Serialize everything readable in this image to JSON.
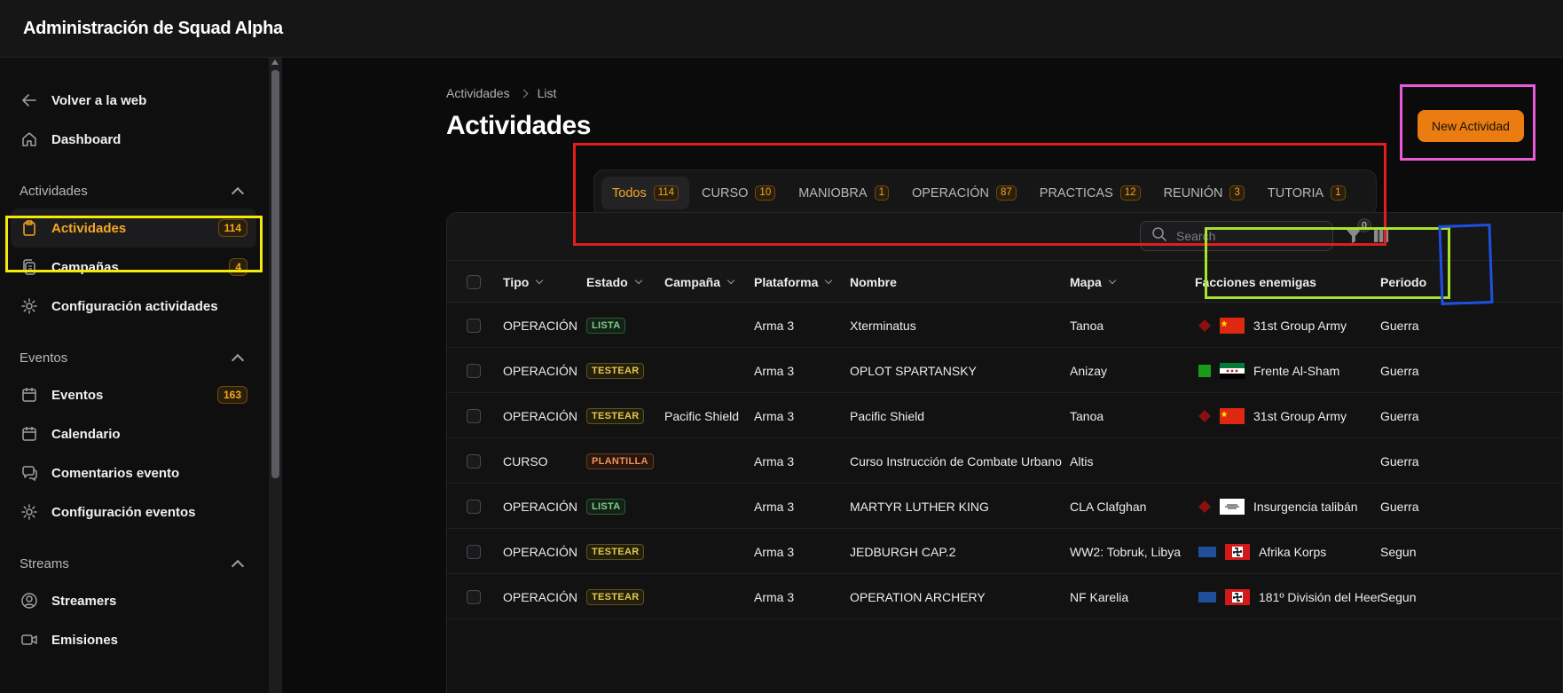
{
  "header": {
    "title": "Administración de Squad Alpha"
  },
  "sidebar": {
    "back_label": "Volver a la web",
    "dashboard_label": "Dashboard",
    "groups": [
      {
        "title": "Actividades",
        "items": [
          {
            "label": "Actividades",
            "badge": "114",
            "icon": "clipboard-icon",
            "active": true
          },
          {
            "label": "Campañas",
            "badge": "4",
            "icon": "clipboards-icon"
          },
          {
            "label": "Configuración actividades",
            "badge": "",
            "icon": "gear-icon"
          }
        ]
      },
      {
        "title": "Eventos",
        "items": [
          {
            "label": "Eventos",
            "badge": "163",
            "icon": "calendar-icon"
          },
          {
            "label": "Calendario",
            "badge": "",
            "icon": "calendar-icon"
          },
          {
            "label": "Comentarios evento",
            "badge": "",
            "icon": "chat-icon"
          },
          {
            "label": "Configuración eventos",
            "badge": "",
            "icon": "gear-icon"
          }
        ]
      },
      {
        "title": "Streams",
        "items": [
          {
            "label": "Streamers",
            "badge": "",
            "icon": "user-circle-icon"
          },
          {
            "label": "Emisiones",
            "badge": "",
            "icon": "video-icon"
          }
        ]
      }
    ]
  },
  "breadcrumb": {
    "parent": "Actividades",
    "current": "List"
  },
  "page": {
    "title": "Actividades",
    "new_button": "New Actividad"
  },
  "tabs": [
    {
      "label": "Todos",
      "count": "114",
      "active": true
    },
    {
      "label": "CURSO",
      "count": "10"
    },
    {
      "label": "MANIOBRA",
      "count": "1"
    },
    {
      "label": "OPERACIÓN",
      "count": "87"
    },
    {
      "label": "PRACTICAS",
      "count": "12"
    },
    {
      "label": "REUNIÓN",
      "count": "3"
    },
    {
      "label": "TUTORIA",
      "count": "1"
    }
  ],
  "toolbar": {
    "search_placeholder": "Search",
    "filter_count": "0"
  },
  "table": {
    "columns": [
      "Tipo",
      "Estado",
      "Campaña",
      "Plataforma",
      "Nombre",
      "Mapa",
      "Facciones enemigas",
      "Periodo"
    ],
    "rows": [
      {
        "tipo": "OPERACIÓN",
        "estado": "LISTA",
        "campana": "",
        "plataforma": "Arma 3",
        "nombre": "Xterminatus",
        "mapa": "Tanoa",
        "faccion": "31st Group Army",
        "faccion_icon": "red-diamond",
        "faccion_flag": "china-flag",
        "periodo": "Guerra"
      },
      {
        "tipo": "OPERACIÓN",
        "estado": "TESTEAR",
        "campana": "",
        "plataforma": "Arma 3",
        "nombre": "OPLOT SPARTANSKY",
        "mapa": "Anizay",
        "faccion": "Frente Al-Sham",
        "faccion_icon": "green-square",
        "faccion_flag": "syria-flag",
        "periodo": "Guerra"
      },
      {
        "tipo": "OPERACIÓN",
        "estado": "TESTEAR",
        "campana": "Pacific Shield",
        "plataforma": "Arma 3",
        "nombre": "Pacific Shield",
        "mapa": "Tanoa",
        "faccion": "31st Group Army",
        "faccion_icon": "red-diamond",
        "faccion_flag": "china-flag",
        "periodo": "Guerra"
      },
      {
        "tipo": "CURSO",
        "estado": "PLANTILLA",
        "campana": "",
        "plataforma": "Arma 3",
        "nombre": "Curso Instrucción de Combate Urbano",
        "mapa": "Altis",
        "faccion": "",
        "faccion_icon": "",
        "faccion_flag": "",
        "periodo": "Guerra"
      },
      {
        "tipo": "OPERACIÓN",
        "estado": "LISTA",
        "campana": "",
        "plataforma": "Arma 3",
        "nombre": "MARTYR LUTHER KING",
        "mapa": "CLA Clafghan",
        "faccion": "Insurgencia talibán",
        "faccion_icon": "red-diamond",
        "faccion_flag": "taliban-flag",
        "periodo": "Guerra"
      },
      {
        "tipo": "OPERACIÓN",
        "estado": "TESTEAR",
        "campana": "",
        "plataforma": "Arma 3",
        "nombre": "JEDBURGH CAP.2",
        "mapa": "WW2: Tobruk, Libya",
        "faccion": "Afrika Korps",
        "faccion_icon": "blue-rect",
        "faccion_flag": "war-flag",
        "periodo": "Segun"
      },
      {
        "tipo": "OPERACIÓN",
        "estado": "TESTEAR",
        "campana": "",
        "plataforma": "Arma 3",
        "nombre": "OPERATION ARCHERY",
        "mapa": "NF Karelia",
        "faccion": "181º División del Heer",
        "faccion_icon": "blue-rect",
        "faccion_flag": "war-flag",
        "periodo": "Segun"
      }
    ]
  },
  "colors": {
    "accent": "#f5a623",
    "button": "#ea7c12",
    "highlight_red": "#e11d1d",
    "highlight_yellow": "#f2ea0a",
    "highlight_magenta": "#e85bd8",
    "highlight_green": "#a6e22e",
    "highlight_blue": "#1f4fe0"
  }
}
